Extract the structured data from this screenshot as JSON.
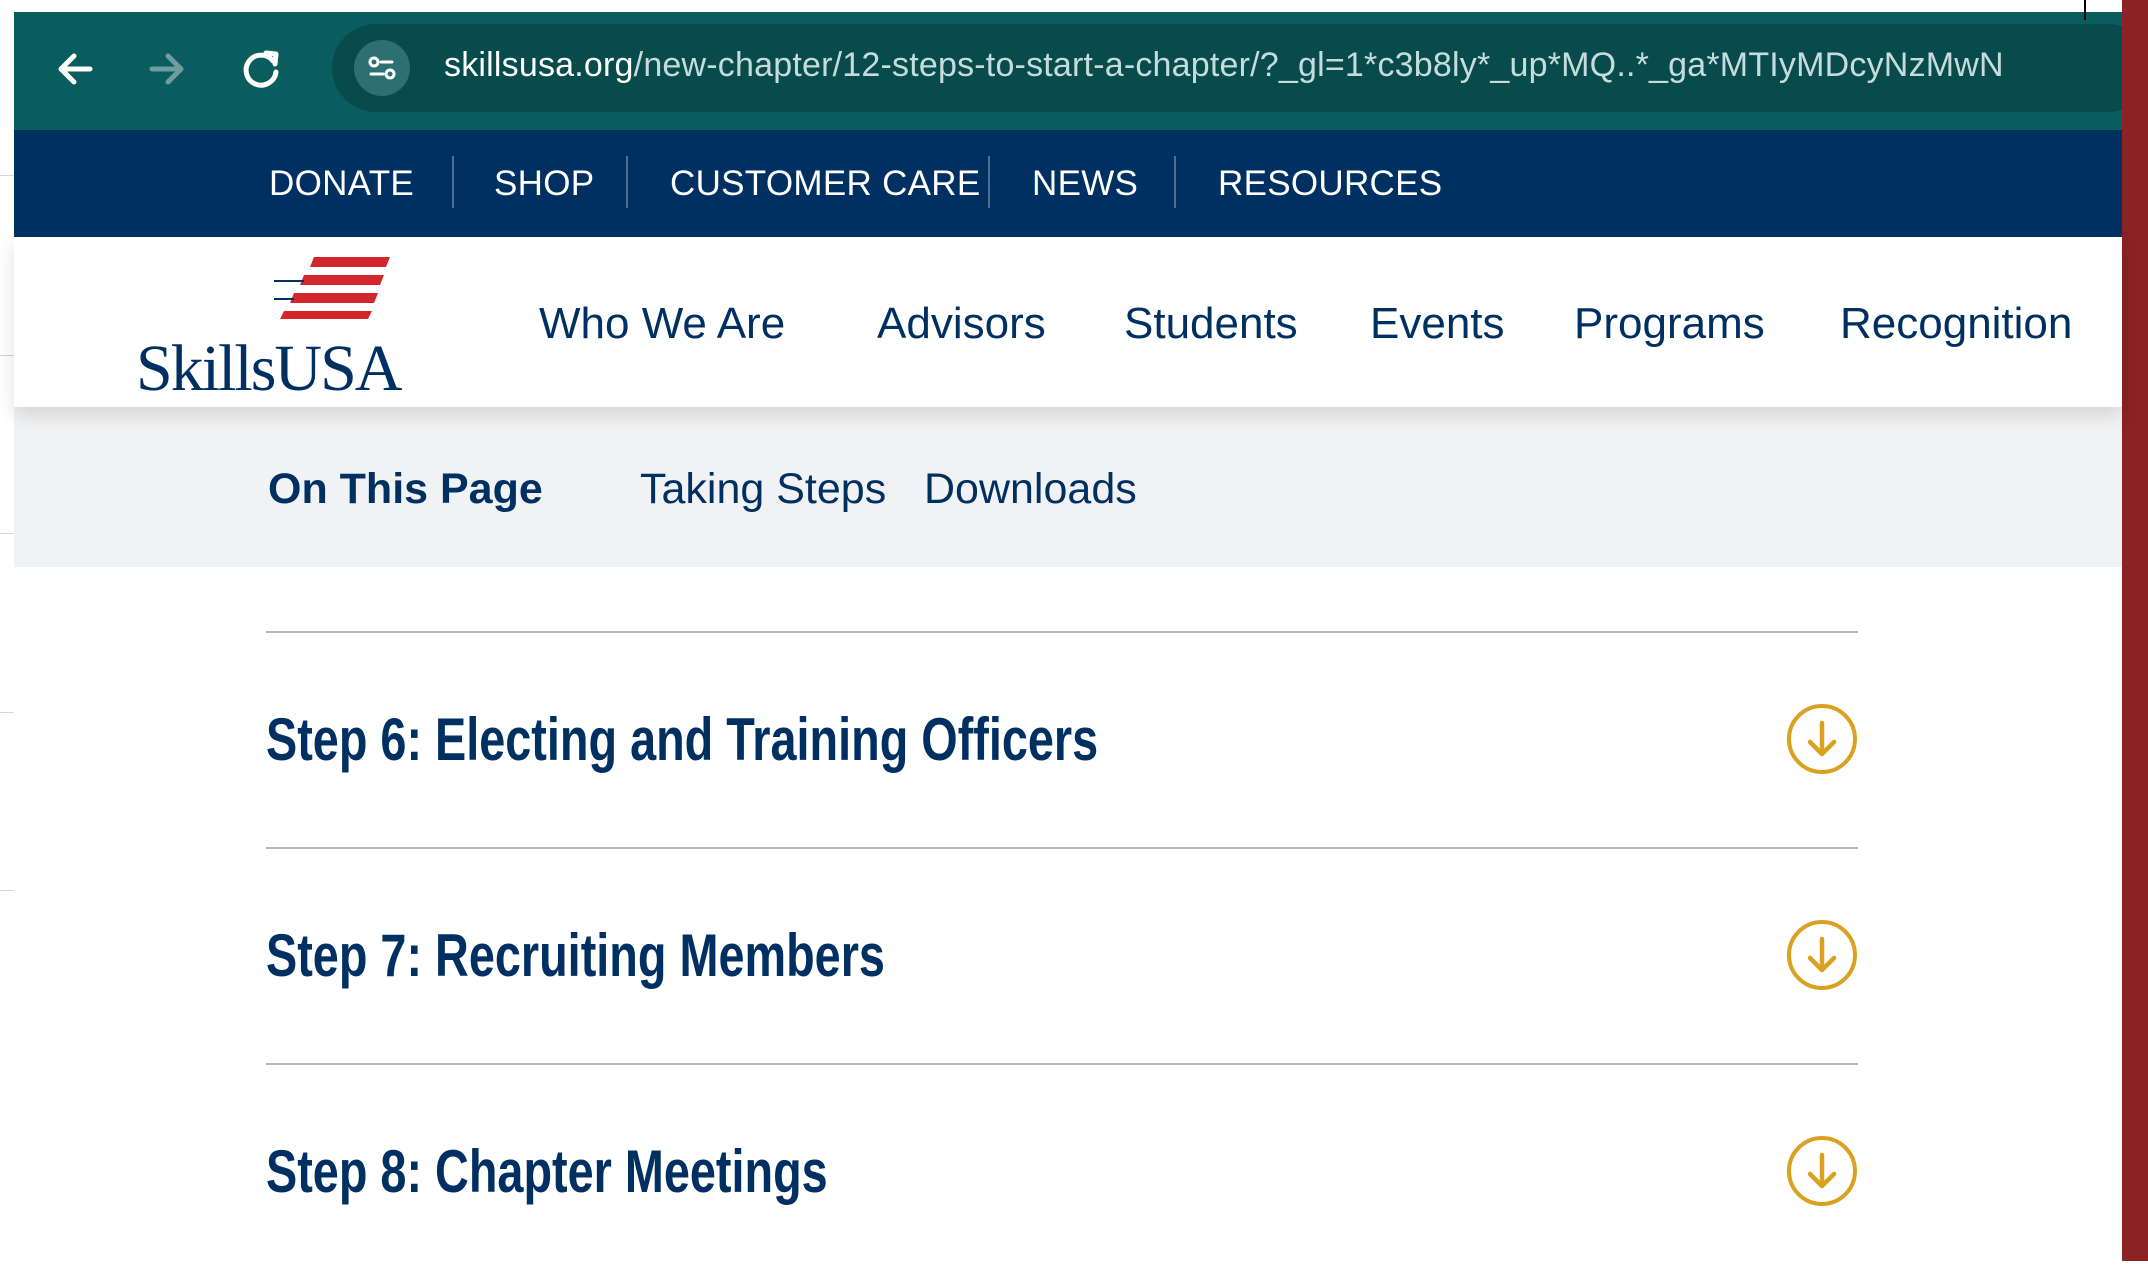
{
  "browser": {
    "url_domain": "skillsusa.org",
    "url_path": "/new-chapter/12-steps-to-start-a-chapter/?_gl=1*c3b8ly*_up*MQ..*_ga*MTIyMDcyNzMwN"
  },
  "utility_nav": {
    "items": [
      "DONATE",
      "SHOP",
      "CUSTOMER CARE",
      "NEWS",
      "RESOURCES"
    ]
  },
  "header": {
    "logo_text": "SkillsUSA",
    "nav": [
      "Who We Are",
      "Advisors",
      "Students",
      "Events",
      "Programs",
      "Recognition"
    ]
  },
  "on_this_page": {
    "title": "On This Page",
    "links": [
      "Taking Steps",
      "Downloads"
    ]
  },
  "accordion": {
    "items": [
      {
        "title": "Step 6: Electing and Training Officers"
      },
      {
        "title": "Step 7: Recruiting Members"
      },
      {
        "title": "Step 8: Chapter Meetings"
      }
    ]
  },
  "colors": {
    "brand_navy": "#003062",
    "browser_teal": "#0a5d5e",
    "accent_gold": "#d9a11f",
    "flag_red": "#d1262c",
    "right_bar_red": "#8b2224"
  }
}
